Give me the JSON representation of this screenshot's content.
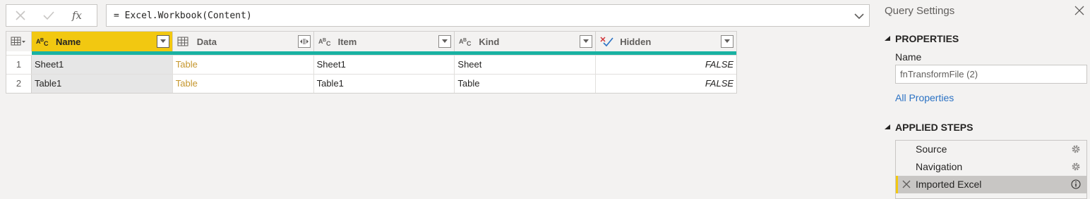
{
  "formula_bar": {
    "cancel_icon": "close-icon",
    "commit_icon": "check-icon",
    "fx_label": "fx",
    "formula": "= Excel.Workbook(Content)"
  },
  "grid": {
    "columns": [
      {
        "label": "Name",
        "type": "text"
      },
      {
        "label": "Data",
        "type": "table"
      },
      {
        "label": "Item",
        "type": "text"
      },
      {
        "label": "Kind",
        "type": "text"
      },
      {
        "label": "Hidden",
        "type": "logical"
      }
    ],
    "type_text_label": "ABC",
    "rows": [
      {
        "num": "1",
        "name": "Sheet1",
        "data": "Table",
        "item": "Sheet1",
        "kind": "Sheet",
        "hidden": "FALSE"
      },
      {
        "num": "2",
        "name": "Table1",
        "data": "Table",
        "item": "Table1",
        "kind": "Table",
        "hidden": "FALSE"
      }
    ]
  },
  "query_settings": {
    "title": "Query Settings",
    "properties_header": "PROPERTIES",
    "name_label": "Name",
    "name_value": "fnTransformFile (2)",
    "all_properties_link": "All Properties",
    "applied_steps_header": "APPLIED STEPS",
    "steps": [
      {
        "label": "Source",
        "icon": "gear-icon"
      },
      {
        "label": "Navigation",
        "icon": "gear-icon"
      },
      {
        "label": "Imported Excel",
        "icon": "info-icon"
      }
    ]
  },
  "colors": {
    "selected_column": "#f2c811",
    "quality_bar": "#19b2a2",
    "link": "#c5962c",
    "hyperlink": "#2b72c4"
  }
}
